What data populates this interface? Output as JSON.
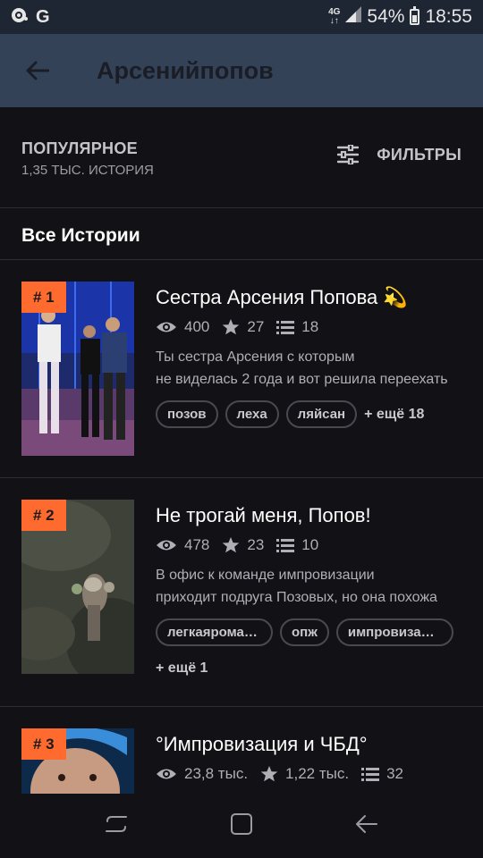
{
  "status_bar": {
    "network": "4G",
    "battery": "54%",
    "battery_level": 0.54,
    "time": "18:55",
    "g_label": "G"
  },
  "app_bar": {
    "title": "Арсенийпопов"
  },
  "sort": {
    "title": "ПОПУЛЯРНОЕ",
    "subtitle": "1,35 ТЫС. ИСТОРИЯ",
    "filters_label": "ФИЛЬТРЫ"
  },
  "section": {
    "title": "Все Истории"
  },
  "stories": [
    {
      "rank": "# 1",
      "title": "Сестра Арсения Попова 💫",
      "reads": "400",
      "votes": "27",
      "parts": "18",
      "desc_line1": "Ты сестра Арсения с которым",
      "desc_line2": "не виделась 2 года и вот решила переехать",
      "tags": [
        "позов",
        "леха",
        "ляйсан"
      ],
      "more": "+ ещё 18"
    },
    {
      "rank": "# 2",
      "title": "Не трогай меня, Попов!",
      "reads": "478",
      "votes": "23",
      "parts": "10",
      "desc_line1": "В офис к команде импровизации",
      "desc_line2": "приходит подруга Позовых, но она похожа",
      "tags": [
        "легкаяромантика",
        "опж",
        "импровизация"
      ],
      "more": "+ ещё 1"
    },
    {
      "rank": "# 3",
      "title": "°Импровизация и ЧБД°",
      "reads": "23,8 тыс.",
      "votes": "1,22 тыс.",
      "parts": "32"
    }
  ],
  "colors": {
    "accent": "#ff6a2f",
    "app_bar": "#344257",
    "status_bar": "#1e2533",
    "background": "#121115"
  }
}
